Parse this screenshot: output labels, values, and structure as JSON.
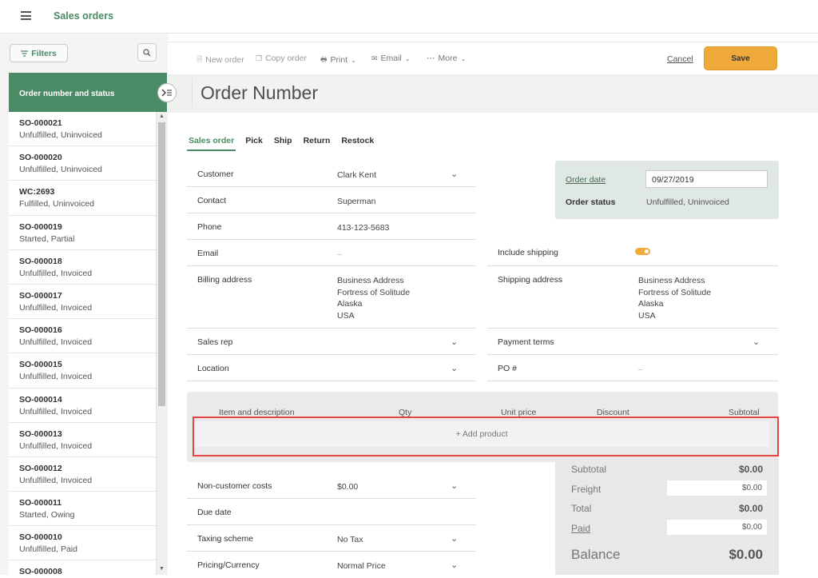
{
  "app": {
    "title": "Sales orders"
  },
  "sidebar": {
    "filters_label": "Filters",
    "list_header": "Order number and status",
    "orders": [
      {
        "number": "SO-000021",
        "status": "Unfulfilled, Uninvoiced"
      },
      {
        "number": "SO-000020",
        "status": "Unfulfilled, Uninvoiced"
      },
      {
        "number": "WC:2693",
        "status": "Fulfilled, Uninvoiced"
      },
      {
        "number": "SO-000019",
        "status": "Started, Partial"
      },
      {
        "number": "SO-000018",
        "status": "Unfulfilled, Invoiced"
      },
      {
        "number": "SO-000017",
        "status": "Unfulfilled, Invoiced"
      },
      {
        "number": "SO-000016",
        "status": "Unfulfilled, Invoiced"
      },
      {
        "number": "SO-000015",
        "status": "Unfulfilled, Invoiced"
      },
      {
        "number": "SO-000014",
        "status": "Unfulfilled, Invoiced"
      },
      {
        "number": "SO-000013",
        "status": "Unfulfilled, Invoiced"
      },
      {
        "number": "SO-000012",
        "status": "Unfulfilled, Invoiced"
      },
      {
        "number": "SO-000011",
        "status": "Started, Owing"
      },
      {
        "number": "SO-000010",
        "status": "Unfulfilled, Paid"
      },
      {
        "number": "SO-000008",
        "status": ""
      }
    ]
  },
  "toolbar": {
    "new_order": "New order",
    "copy_order": "Copy order",
    "print": "Print",
    "email": "Email",
    "more": "More",
    "cancel": "Cancel",
    "save": "Save"
  },
  "order": {
    "title_placeholder": "Order Number",
    "tabs": [
      "Sales order",
      "Pick",
      "Ship",
      "Return",
      "Restock"
    ],
    "customer_label": "Customer",
    "customer": "Clark Kent",
    "contact_label": "Contact",
    "contact": "Superman",
    "phone_label": "Phone",
    "phone": "413-123-5683",
    "email_label": "Email",
    "email": "–",
    "billing_label": "Billing address",
    "billing": [
      "Business Address",
      "Fortress of Solitude",
      "Alaska",
      "USA"
    ],
    "salesrep_label": "Sales rep",
    "location_label": "Location",
    "order_date_label": "Order date",
    "order_date": "09/27/2019",
    "order_status_label": "Order status",
    "order_status": "Unfulfilled, Uninvoiced",
    "include_shipping_label": "Include shipping",
    "include_shipping": "on",
    "shipping_label": "Shipping address",
    "shipping": [
      "Business Address",
      "Fortress of Solitude",
      "Alaska",
      "USA"
    ],
    "payment_terms_label": "Payment terms",
    "po_label": "PO #",
    "po": "–"
  },
  "items": {
    "headers": [
      "Item and description",
      "Qty",
      "Unit price",
      "Discount",
      "Subtotal"
    ],
    "add_product": "+ Add product"
  },
  "extra": {
    "noncust_label": "Non-customer costs",
    "noncust": "$0.00",
    "due_label": "Due date",
    "taxing_label": "Taxing scheme",
    "taxing": "No Tax",
    "pricing_label": "Pricing/Currency",
    "pricing": "Normal Price"
  },
  "totals": {
    "subtotal_label": "Subtotal",
    "subtotal": "$0.00",
    "freight_label": "Freight",
    "freight": "$0.00",
    "total_label": "Total",
    "total": "$0.00",
    "paid_label": "Paid",
    "paid": "$0.00",
    "balance_label": "Balance",
    "balance": "$0.00"
  },
  "colors": {
    "accent": "#4a8a64",
    "save": "#efaa3a",
    "highlight": "#e54545"
  }
}
